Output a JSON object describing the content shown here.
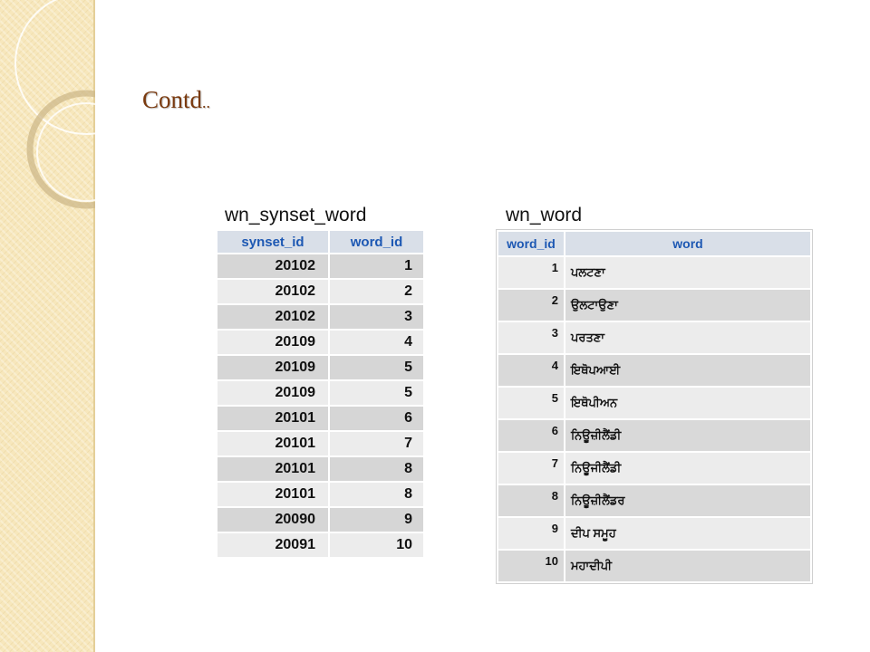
{
  "slide": {
    "title": "Contd",
    "title_suffix": ".."
  },
  "left_table": {
    "label": "wn_synset_word",
    "headers": [
      "synset_id",
      "word_id"
    ],
    "rows": [
      [
        "20102",
        "1"
      ],
      [
        "20102",
        "2"
      ],
      [
        "20102",
        "3"
      ],
      [
        "20109",
        "4"
      ],
      [
        "20109",
        "5"
      ],
      [
        "20109",
        "5"
      ],
      [
        "20101",
        "6"
      ],
      [
        "20101",
        "7"
      ],
      [
        "20101",
        "8"
      ],
      [
        "20101",
        "8"
      ],
      [
        "20090",
        "9"
      ],
      [
        "20091",
        "10"
      ]
    ]
  },
  "right_table": {
    "label": "wn_word",
    "headers": [
      "word_id",
      "word"
    ],
    "rows": [
      [
        "1",
        "ਪਲਟਣਾ"
      ],
      [
        "2",
        "ਉਲਟਾਉਣਾ"
      ],
      [
        "3",
        "ਪਰਤਣਾ"
      ],
      [
        "4",
        "ਇਥੋਪਆਈ"
      ],
      [
        "5",
        "ਇਥੋਪੀਅਨ"
      ],
      [
        "6",
        "ਨਿਊਜ਼ੀਲੈਂਡੀ"
      ],
      [
        "7",
        "ਨਿਊਜੀਲੈਂਡੀ"
      ],
      [
        "8",
        "ਨਿਊਜ਼ੀਲੈਂਡਰ"
      ],
      [
        "9",
        "ਦੀਪ ਸਮੂਹ"
      ],
      [
        "10",
        "ਮਹਾਦੀਪੀ"
      ]
    ]
  }
}
